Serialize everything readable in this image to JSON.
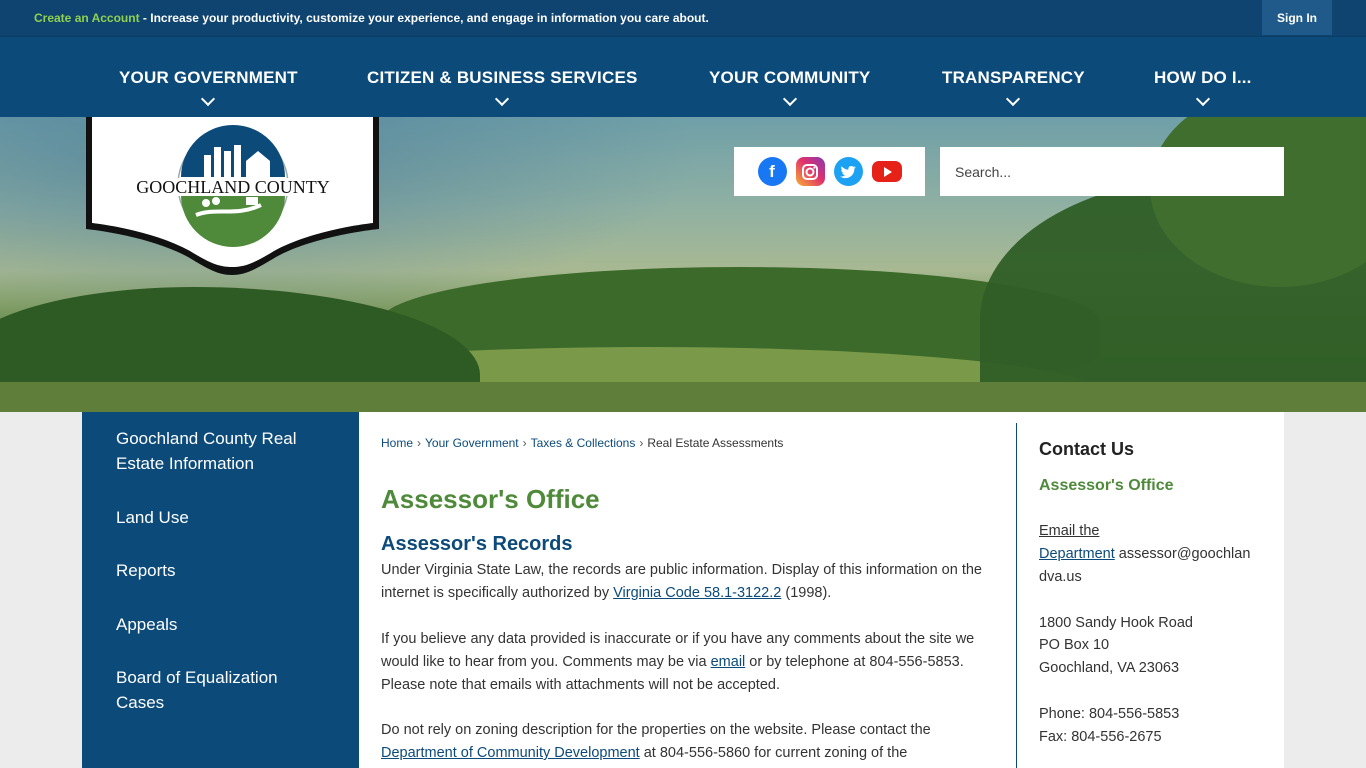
{
  "topbar": {
    "create_account": "Create an Account",
    "message": " - Increase your productivity, customize your experience, and engage in information you care about.",
    "sign_in": "Sign In"
  },
  "nav": {
    "items": [
      {
        "label": "YOUR GOVERNMENT"
      },
      {
        "label": "CITIZEN & BUSINESS SERVICES"
      },
      {
        "label": "YOUR COMMUNITY"
      },
      {
        "label": "TRANSPARENCY"
      },
      {
        "label": "HOW DO I..."
      }
    ]
  },
  "logo": {
    "text": "GOOCHLAND COUNTY"
  },
  "social": {
    "icons": [
      "facebook-icon",
      "instagram-icon",
      "twitter-icon",
      "youtube-icon"
    ]
  },
  "search": {
    "placeholder": "Search..."
  },
  "sidebar": {
    "items": [
      {
        "label": "Goochland County Real Estate Information"
      },
      {
        "label": "Land Use"
      },
      {
        "label": "Reports"
      },
      {
        "label": "Appeals"
      },
      {
        "label": "Board of Equalization Cases"
      }
    ]
  },
  "breadcrumb": {
    "home": "Home",
    "level1": "Your Government",
    "level2": "Taxes & Collections",
    "current": "Real Estate Assessments",
    "separator": "›"
  },
  "main": {
    "title": "Assessor's Office",
    "section_title": "Assessor's Records",
    "p1_a": "Under Virginia State Law, the records are public information. Display of this information on the internet is specifically authorized by ",
    "p1_link": "Virginia Code 58.1-3122.2",
    "p1_b": " (1998).",
    "p2_a": "If you believe any data provided is inaccurate or if you have any comments about the site we would like to hear from you. Comments may be via ",
    "p2_link": "email",
    "p2_b": " or by telephone at 804-556-5853. Please note that emails with attachments will not be accepted.",
    "p3_a": "Do not rely on zoning description for the properties on the website. Please contact the ",
    "p3_link": "Department of Community Development",
    "p3_b": " at 804-556-5860 for current zoning of the"
  },
  "contact": {
    "heading": "Contact Us",
    "dept": "Assessor's Office",
    "email_link_1": "Email the",
    "email_link_2": "Department",
    "email_1": " assessor@goochlan",
    "email_2": "dva.us",
    "address_1": "1800 Sandy Hook Road",
    "address_2": "PO Box 10",
    "address_3": "Goochland, VA 23063",
    "phone": "Phone: 804-556-5853",
    "fax": "Fax: 804-556-2675"
  },
  "colors": {
    "navy": "#0c4a7a",
    "green": "#4f8a3b",
    "accent_green": "#8fd14f"
  }
}
